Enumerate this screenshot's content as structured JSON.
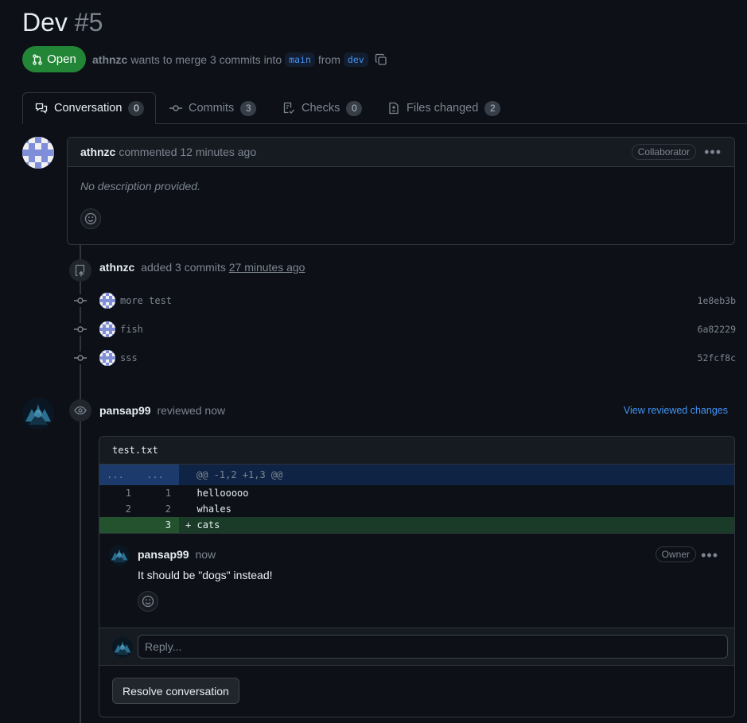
{
  "pr": {
    "title": "Dev",
    "number": "#5",
    "state": "Open",
    "author": "athnzc",
    "merge_text": "wants to merge 3 commits into",
    "base_branch": "main",
    "from_text": "from",
    "head_branch": "dev"
  },
  "tabs": [
    {
      "label": "Conversation",
      "count": "0"
    },
    {
      "label": "Commits",
      "count": "3"
    },
    {
      "label": "Checks",
      "count": "0"
    },
    {
      "label": "Files changed",
      "count": "2"
    }
  ],
  "first_comment": {
    "author": "athnzc",
    "action": "commented 12 minutes ago",
    "role": "Collaborator",
    "body": "No description provided."
  },
  "commits_event": {
    "author": "athnzc",
    "action": "added 3 commits",
    "time": "27 minutes ago",
    "commits": [
      {
        "message": "more test",
        "sha": "1e8eb3b"
      },
      {
        "message": "fish",
        "sha": "6a82229"
      },
      {
        "message": "sss",
        "sha": "52fcf8c"
      }
    ]
  },
  "review": {
    "author": "pansap99",
    "action": "reviewed now",
    "view_link": "View reviewed changes",
    "file": "test.txt",
    "hunk": "@@ -1,2 +1,3 @@",
    "hunk_ln": "...",
    "lines": [
      {
        "old": "1",
        "new": "1",
        "sign": " ",
        "text": "hellooooo"
      },
      {
        "old": "2",
        "new": "2",
        "sign": " ",
        "text": "whales"
      },
      {
        "old": "",
        "new": "3",
        "sign": "+",
        "text": "cats"
      }
    ],
    "comment": {
      "author": "pansap99",
      "time": "now",
      "role": "Owner",
      "body": "It should be \"dogs\" instead!"
    },
    "reply_placeholder": "Reply...",
    "resolve_label": "Resolve conversation"
  },
  "colors": {
    "accent_blue": "#4493f8",
    "open_green": "#238636",
    "background": "#0d1117"
  }
}
